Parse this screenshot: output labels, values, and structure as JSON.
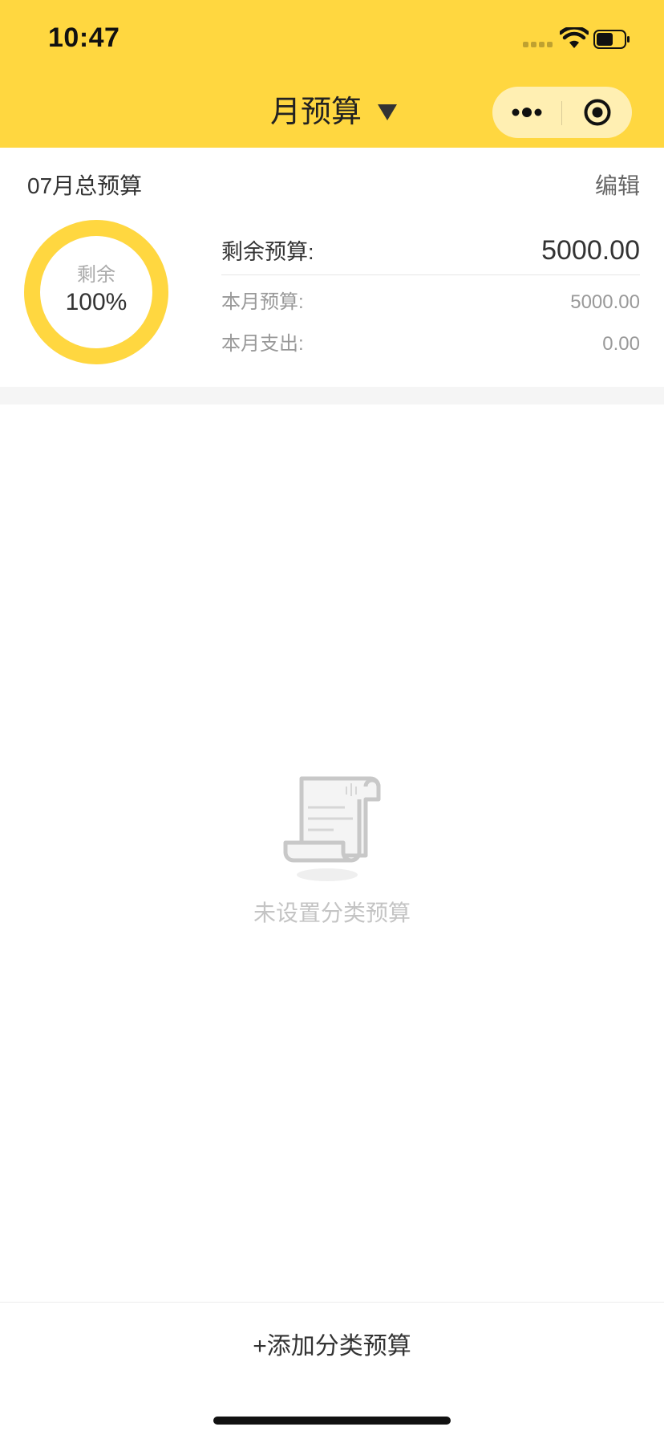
{
  "status_bar": {
    "time": "10:47"
  },
  "nav": {
    "title": "月预算",
    "caret_icon": "caret-down-icon",
    "more_icon": "more-dots-icon",
    "close_icon": "target-close-icon"
  },
  "summary": {
    "month_title": "07月总预算",
    "edit_label": "编辑",
    "ring_label": "剩余",
    "ring_percent": "100%",
    "ring_fraction": 1.0,
    "remaining_label": "剩余预算:",
    "remaining_value": "5000.00",
    "month_budget_label": "本月预算:",
    "month_budget_value": "5000.00",
    "month_expense_label": "本月支出:",
    "month_expense_value": "0.00"
  },
  "empty_state": {
    "icon": "receipt-scroll-icon",
    "text": "未设置分类预算"
  },
  "bottom": {
    "add_label": "+添加分类预算"
  },
  "colors": {
    "accent": "#FFD740",
    "text_primary": "#333333",
    "text_secondary": "#999999",
    "empty_text": "#c4c4c4"
  }
}
